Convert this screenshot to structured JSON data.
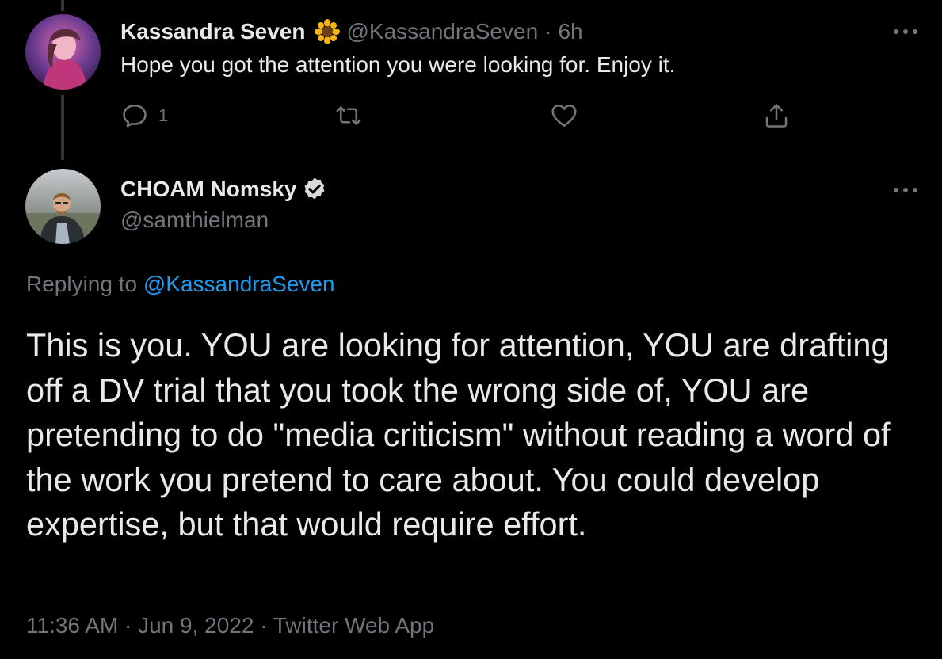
{
  "parent_tweet": {
    "display_name": "Kassandra Seven",
    "name_emoji": "sunflower-emoji",
    "handle": "@KassandraSeven",
    "separator": "·",
    "time_ago": "6h",
    "text": "Hope you got the attention you were looking for. Enjoy it.",
    "reply_count": "1",
    "more_icon": "more-horizontal-icon"
  },
  "main_tweet": {
    "display_name": "CHOAM Nomsky",
    "verified": true,
    "handle": "@samthielman",
    "replying_prefix": "Replying to ",
    "replying_handle": "@KassandraSeven",
    "body": "This is you. YOU are looking for attention, YOU are drafting off a DV trial that you took the wrong side of, YOU are pretending to do \"media criticism\" without reading a word of the work you pretend to care about. You could develop expertise, but that would require effort.",
    "timestamp": "11:36 AM · Jun 9, 2022 · Twitter Web App",
    "more_icon": "more-horizontal-icon"
  },
  "icons": {
    "reply": "reply-icon",
    "retweet": "retweet-icon",
    "like": "heart-icon",
    "share": "share-icon",
    "verified": "verified-badge-icon"
  },
  "colors": {
    "background": "#000000",
    "text_primary": "#e7e9ea",
    "text_secondary": "#71767b",
    "accent": "#1d9bf0",
    "thread_line": "#333639"
  }
}
